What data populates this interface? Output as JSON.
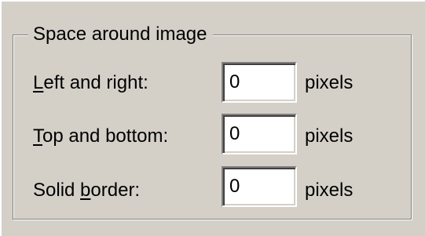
{
  "group": {
    "title": "Space around image"
  },
  "rows": [
    {
      "label_mnemonic": "L",
      "label_rest": "eft and right:",
      "label_pre": "",
      "value": "0",
      "unit": "pixels"
    },
    {
      "label_mnemonic": "T",
      "label_rest": "op and bottom:",
      "label_pre": "",
      "value": "0",
      "unit": "pixels"
    },
    {
      "label_pre": "Solid ",
      "label_mnemonic": "b",
      "label_rest": "order:",
      "value": "0",
      "unit": "pixels"
    }
  ]
}
